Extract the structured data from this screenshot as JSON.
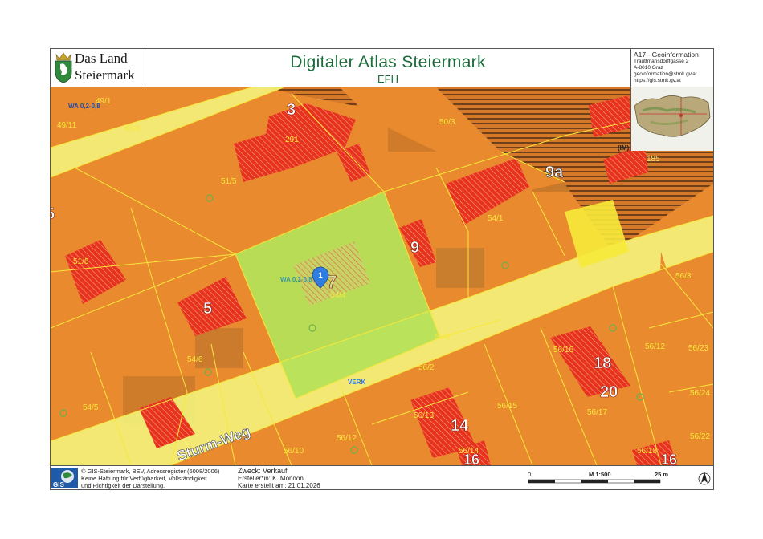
{
  "header": {
    "logo_line1": "Das Land",
    "logo_line2": "Steiermark",
    "title": "Digitaler Atlas Steiermark",
    "subtitle": "EFH"
  },
  "agency": {
    "name": "A17 - Geoinformation",
    "street": "Trauttmansdorffgasse 2",
    "city": "A-8010 Graz",
    "email": "geoinformation@stmk.gv.at",
    "web": "https://gis.stmk.gv.at"
  },
  "map": {
    "marker_label": "1",
    "street_name": "Sturm-Weg",
    "zone_labels": [
      "WA 0,2-0,8",
      "WA 0,2-0,8",
      "VERK"
    ],
    "parcel_labels": [
      "49/1",
      "49/11",
      "49/6",
      "291",
      "51/5",
      "50/3",
      "185",
      "54/1",
      "51/6",
      "54/4",
      "56/3",
      "54/6",
      "56/6",
      "56/2",
      "56/16",
      "56/12",
      "56/23",
      "54/5",
      "56/15",
      "56/17",
      "56/24",
      "56/13",
      "56/12",
      "56/10",
      "56/14",
      "56/18",
      "56/22"
    ],
    "house_numbers": [
      "3",
      "9a",
      "9",
      "7",
      "5",
      "18",
      "20",
      "14",
      "16",
      "16",
      "5"
    ],
    "im_label": "(IM)"
  },
  "footer": {
    "copyright_line1": "© GIS-Steiermark, BEV, Adressregister (6008/2006)",
    "copyright_line2": "Keine Haftung für Verfügbarkeit, Vollständigkeit",
    "copyright_line3": "und Richtigkeit der Darstellung.",
    "purpose": "Zweck: Verkauf",
    "creator": "Ersteller*in: K. Mondon",
    "created": "Karte erstellt am: 21.01.2026",
    "gis_label": "GIS"
  },
  "scale": {
    "start": "0",
    "ratio": "M 1:500",
    "end": "25 m"
  },
  "colors": {
    "zone_orange": "#e98a2e",
    "hatch_red": "#e8331c",
    "road_yellow": "#f2f07a",
    "parcel_line": "#f7e83a",
    "selected_green": "#b6e35a",
    "marker_blue": "#2f7de1",
    "title_green": "#1c6b3a"
  }
}
